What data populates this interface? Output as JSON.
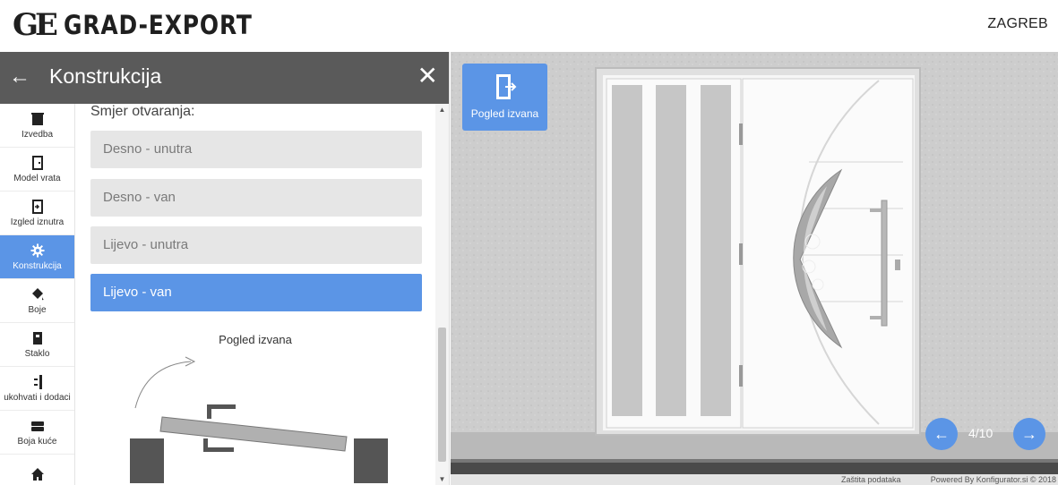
{
  "header": {
    "logo_mark": "GE",
    "brand": "GRAD-EXPORT",
    "city": "ZAGREB"
  },
  "panel": {
    "title": "Konstrukcija",
    "back_icon": "arrow-left-icon",
    "close_icon": "close-icon"
  },
  "sidenav": {
    "items": [
      {
        "label": "Izvedba",
        "icon": "door-solid-icon"
      },
      {
        "label": "Model vrata",
        "icon": "door-outline-icon"
      },
      {
        "label": "Izgled iznutra",
        "icon": "door-enter-icon"
      },
      {
        "label": "Konstrukcija",
        "icon": "gear-icon",
        "active": true
      },
      {
        "label": "Boje",
        "icon": "paint-bucket-icon"
      },
      {
        "label": "Staklo",
        "icon": "glass-door-icon"
      },
      {
        "label": "ukohvati i dodaci",
        "icon": "handle-icon"
      },
      {
        "label": "Boja kuće",
        "icon": "house-color-icon"
      },
      {
        "label": "",
        "icon": "house-icon"
      }
    ]
  },
  "opening": {
    "label": "Smjer otvaranja:",
    "options": [
      {
        "label": "Desno - unutra",
        "selected": false
      },
      {
        "label": "Desno - van",
        "selected": false
      },
      {
        "label": "Lijevo - unutra",
        "selected": false
      },
      {
        "label": "Lijevo - van",
        "selected": true
      }
    ],
    "diagram_caption": "Pogled izvana"
  },
  "preview": {
    "view_button_label": "Pogled izvana",
    "counter": "4/10",
    "prev_icon": "arrow-left-icon",
    "next_icon": "arrow-right-icon",
    "privacy": "Zaštita podataka",
    "powered": "Powered By Konfigurator.si © 2018"
  },
  "colors": {
    "accent": "#5b95e6",
    "panel_header": "#5a5a5a",
    "option_bg": "#e6e6e6"
  }
}
